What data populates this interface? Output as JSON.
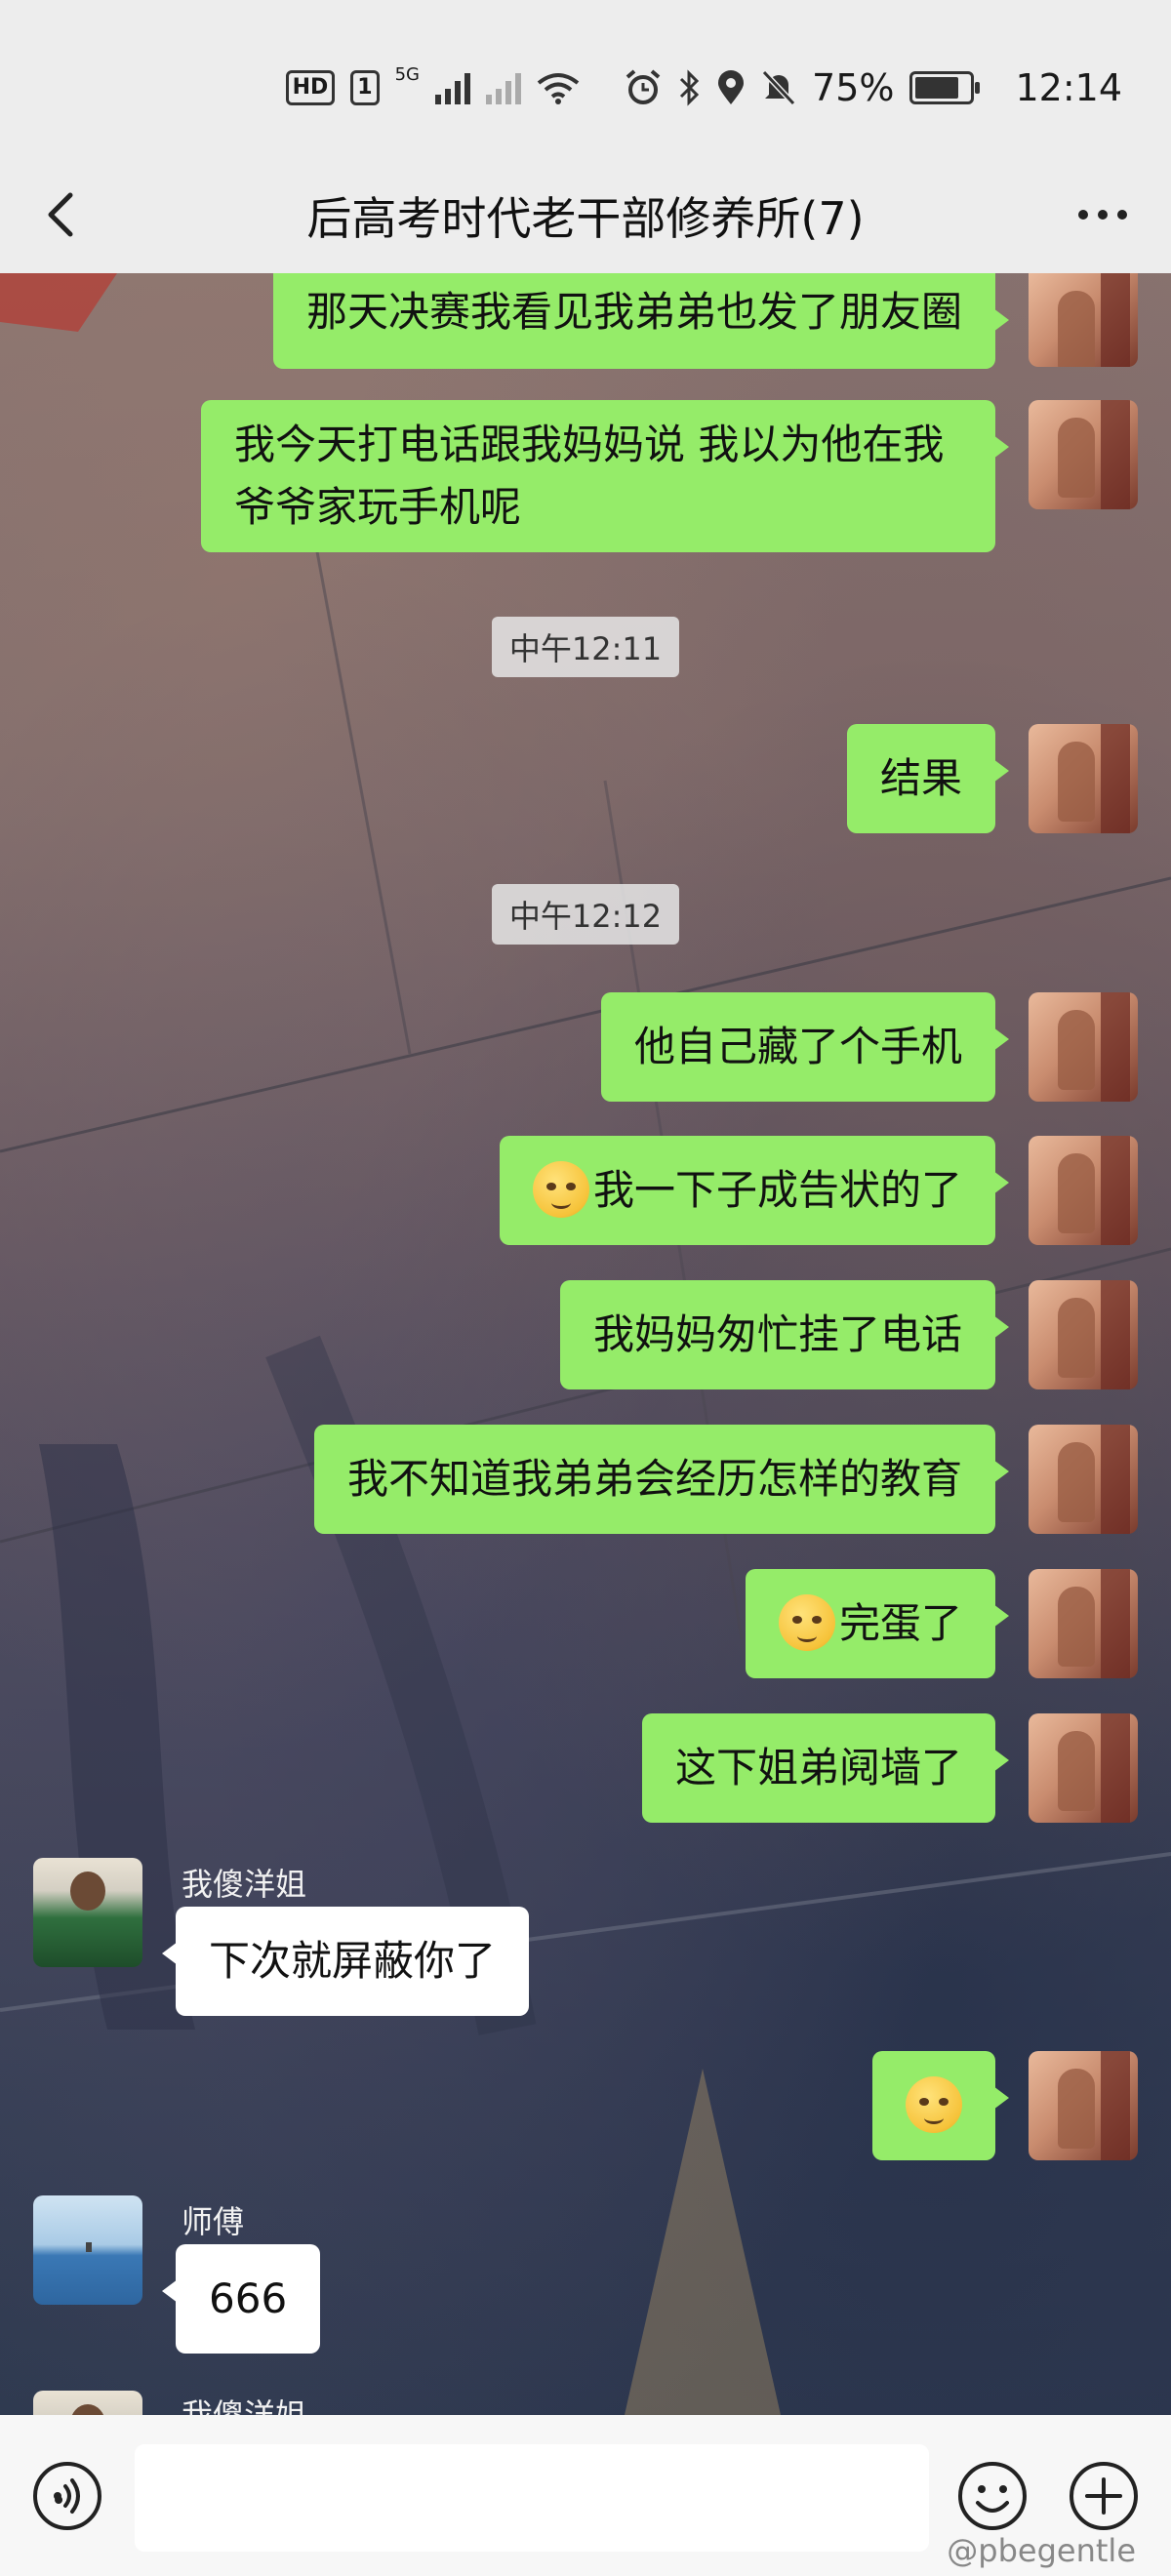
{
  "status_bar": {
    "hd_label": "HD",
    "sim_label": "1",
    "network_label": "5G",
    "battery_percent": "75%",
    "time": "12:14",
    "icons": [
      "alarm-icon",
      "bluetooth-icon",
      "location-icon",
      "mute-icon",
      "wifi-icon"
    ]
  },
  "header": {
    "title": "后高考时代老干部修养所(7)"
  },
  "messages": {
    "m1": "那天决赛我看见我弟弟也发了朋友圈",
    "m2": "我今天打电话跟我妈妈说 我以为他在我爷爷家玩手机呢",
    "ts1": "中午12:11",
    "m3": "结果",
    "ts2": "中午12:12",
    "m4": "他自己藏了个手机",
    "m5": "我一下子成告状的了",
    "m6": "我妈妈匆忙挂了电话",
    "m7": "我不知道我弟弟会经历怎样的教育",
    "m8": "完蛋了",
    "m9": "这下姐弟阋墙了",
    "sender1": "我傻洋姐",
    "m10": "下次就屏蔽你了",
    "sender2": "师傅",
    "m11": "666",
    "sender3": "我傻洋姐"
  },
  "input": {
    "placeholder": ""
  },
  "watermark": "@pbegentle",
  "colors": {
    "sent_bubble": "#95ec69",
    "received_bubble": "#ffffff",
    "bar_bg": "#ededed"
  }
}
